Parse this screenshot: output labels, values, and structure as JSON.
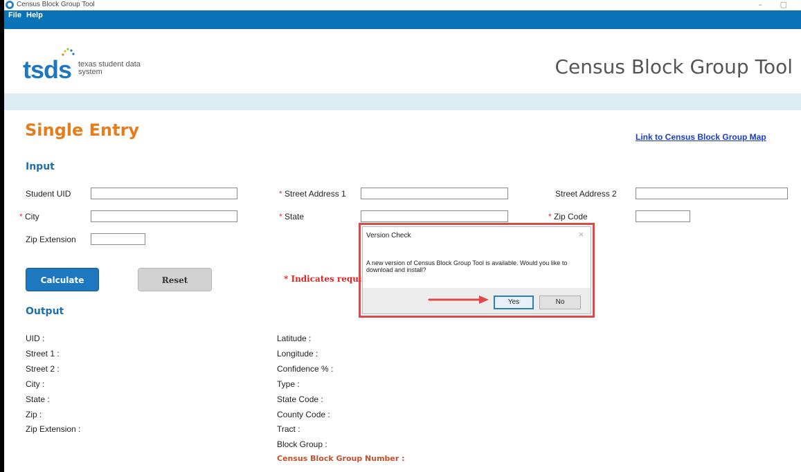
{
  "window": {
    "title": "Census Block Group Tool",
    "minimize_glyph": "–",
    "maximize_glyph": "▢"
  },
  "menu": {
    "items": [
      "File",
      "Help"
    ]
  },
  "header": {
    "logo_text": "tsds",
    "logo_sub": "texas student data system",
    "app_title": "Census Block Group Tool"
  },
  "page": {
    "section_title": "Single Entry",
    "map_link": "Link to Census Block Group Map",
    "input_heading": "Input",
    "output_heading": "Output"
  },
  "input": {
    "student_uid": {
      "label": "Student UID",
      "value": ""
    },
    "street1": {
      "label": "Street Address 1",
      "value": ""
    },
    "street2": {
      "label": "Street Address 2",
      "value": ""
    },
    "city": {
      "label": "City",
      "value": ""
    },
    "state": {
      "label": "State",
      "value": ""
    },
    "zip": {
      "label": "Zip Code",
      "value": ""
    },
    "zip_ext": {
      "label": "Zip Extension",
      "value": ""
    },
    "required_marker": "*"
  },
  "buttons": {
    "calculate": "Calculate",
    "reset": "Reset"
  },
  "required_note": "* Indicates required",
  "output": {
    "left": [
      "UID :",
      "Street 1 :",
      "Street 2 :",
      "City :",
      "State :",
      "Zip :",
      "Zip Extension :"
    ],
    "right": [
      "Latitude :",
      "Longitude :",
      "Confidence % :",
      "Type :",
      "State Code :",
      "County Code :",
      "Tract :",
      "Block Group :"
    ],
    "census_block_group_number": "Census Block Group Number :"
  },
  "dialog": {
    "title": "Version Check",
    "close_glyph": "×",
    "message": "A new version of Census Block Group Tool is available. Would you like to download and install?",
    "yes": "Yes",
    "no": "No"
  },
  "colors": {
    "menubar": "#0b73b8",
    "accent_orange": "#e87b1a",
    "heading_blue": "#1d6fb0",
    "required_red": "#e02020",
    "annotation_red": "#e04848"
  },
  "icons": [
    "app-location-icon",
    "arrow-annotation-icon"
  ]
}
